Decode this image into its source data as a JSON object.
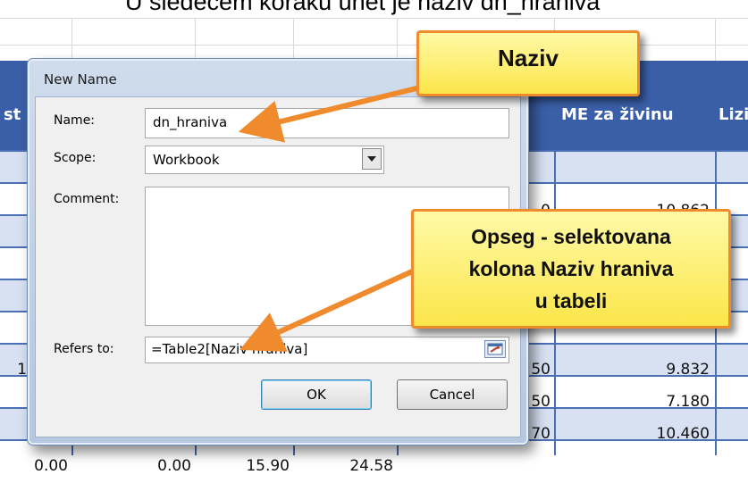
{
  "caption": "U sledećem koraku unet je naziv dn_hraniva",
  "table": {
    "headers": {
      "col_st": "st",
      "col_me": "ME za živinu",
      "col_lizi": "Lizi"
    },
    "right_values": [
      "10.862",
      "9.832",
      "7.180",
      "10.460"
    ],
    "partial_values": [
      "0",
      "50",
      "50",
      "70"
    ],
    "partial_left": "1",
    "bottom_row": [
      "0.00",
      "0.00",
      "15.90",
      "24.58"
    ]
  },
  "dialog": {
    "title": "New Name",
    "name_label": "Name:",
    "name_value": "dn_hraniva",
    "scope_label": "Scope:",
    "scope_value": "Workbook",
    "comment_label": "Comment:",
    "comment_value": "",
    "refers_label": "Refers to:",
    "refers_value": "=Table2[Naziv hraniva]",
    "ok_label": "OK",
    "cancel_label": "Cancel"
  },
  "callouts": {
    "naziv": "Naziv",
    "opseg_line1": "Opseg - selektovana",
    "opseg_line2": "kolona Naziv hraniva",
    "opseg_line3": "u tabeli"
  },
  "colors": {
    "header_blue": "#3a5fa8",
    "row_blue": "#d7e1f2",
    "callout_fill": "#fbe64a",
    "callout_border": "#ef8a2d"
  }
}
